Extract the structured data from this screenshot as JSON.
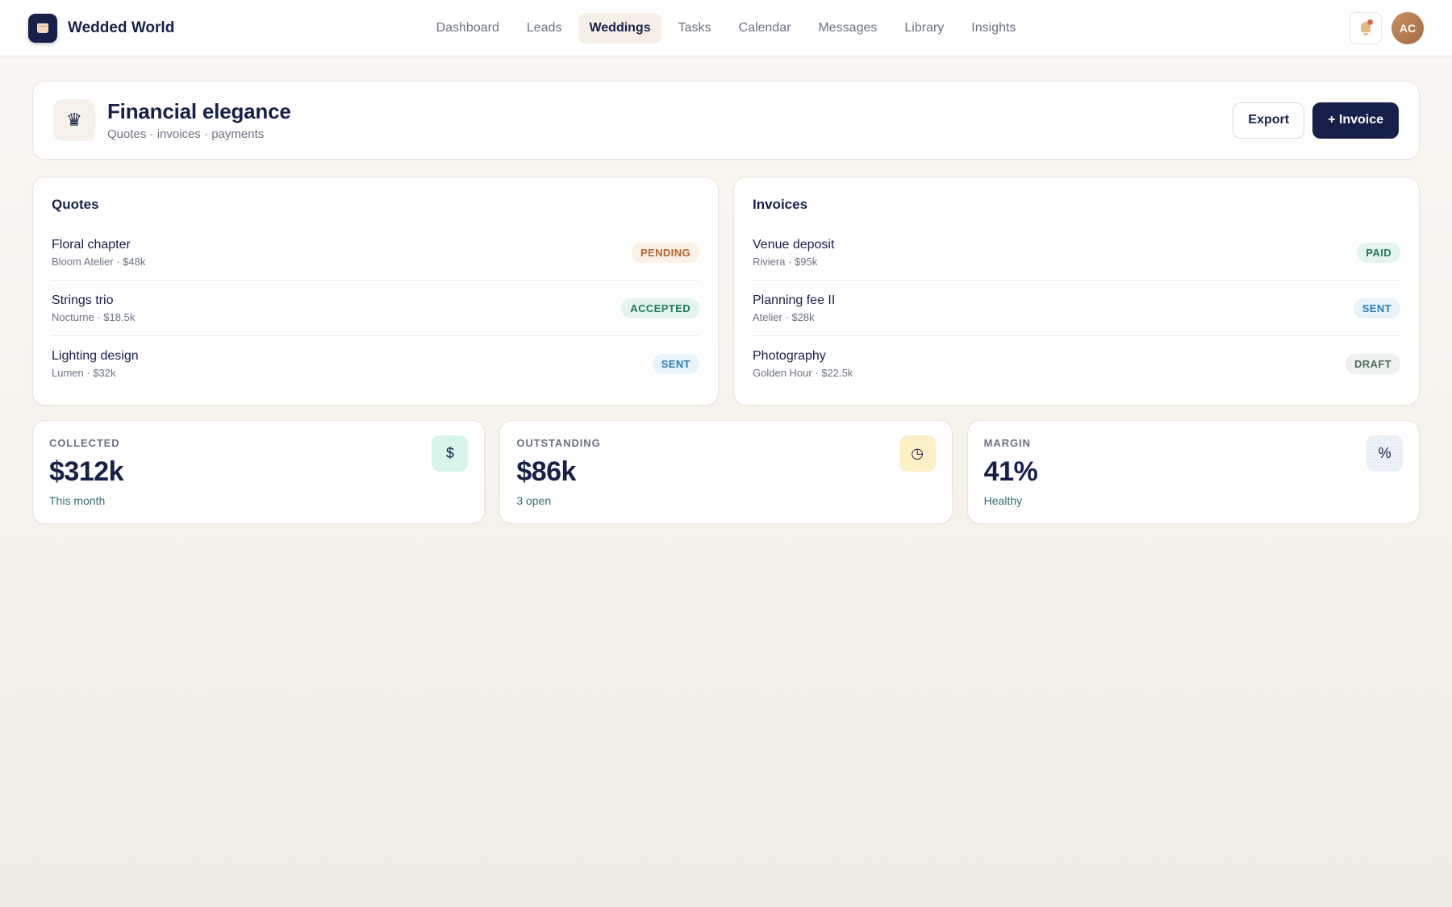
{
  "brand": {
    "name": "Wedded World",
    "logo_icon": "cake-icon"
  },
  "nav": {
    "items": [
      {
        "label": "Dashboard"
      },
      {
        "label": "Leads"
      },
      {
        "label": "Weddings",
        "active": true
      },
      {
        "label": "Tasks"
      },
      {
        "label": "Calendar"
      },
      {
        "label": "Messages"
      },
      {
        "label": "Library"
      },
      {
        "label": "Insights"
      }
    ]
  },
  "topbar": {
    "notification_icon": "bell-icon",
    "avatar_initials": "AC"
  },
  "header": {
    "icon": "♛",
    "title": "Financial elegance",
    "subtitle": "Quotes · invoices · payments",
    "export_label": "Export",
    "invoice_label": "+ Invoice"
  },
  "quotes": {
    "title": "Quotes",
    "items": [
      {
        "name": "Floral chapter",
        "meta": "Bloom Atelier · $48k",
        "status": "PENDING"
      },
      {
        "name": "Strings trio",
        "meta": "Nocturne · $18.5k",
        "status": "ACCEPTED"
      },
      {
        "name": "Lighting design",
        "meta": "Lumen · $32k",
        "status": "SENT"
      }
    ]
  },
  "invoices": {
    "title": "Invoices",
    "items": [
      {
        "name": "Venue deposit",
        "meta": "Riviera · $95k",
        "status": "PAID"
      },
      {
        "name": "Planning fee II",
        "meta": "Atelier · $28k",
        "status": "SENT"
      },
      {
        "name": "Photography",
        "meta": "Golden Hour · $22.5k",
        "status": "DRAFT"
      }
    ]
  },
  "stats": [
    {
      "label": "COLLECTED",
      "value": "$312k",
      "note": "This month",
      "icon": "$",
      "icon_name": "dollar-icon"
    },
    {
      "label": "OUTSTANDING",
      "value": "$86k",
      "note": "3 open",
      "icon": "◷",
      "icon_name": "clock-icon"
    },
    {
      "label": "MARGIN",
      "value": "41%",
      "note": "Healthy",
      "icon": "%",
      "icon_name": "percent-icon"
    }
  ],
  "colors": {
    "primary": "#16204a",
    "pending": "#b5642f",
    "accepted": "#1f7a5a",
    "sent": "#2b7cbf",
    "draft": "#4f6b5c"
  }
}
